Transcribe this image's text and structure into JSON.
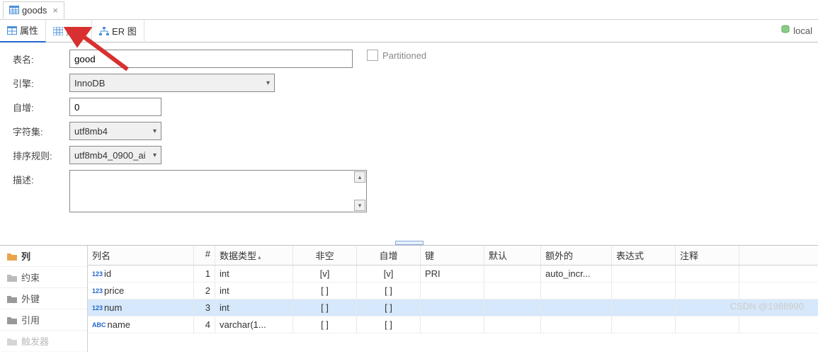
{
  "topTab": {
    "title": "goods"
  },
  "subtabs": {
    "properties": "属性",
    "data": "数据",
    "erDiagram": "ER 图"
  },
  "breadcrumb": {
    "local": "local"
  },
  "form": {
    "tableNameLabel": "表名:",
    "tableNameValue": "good",
    "engineLabel": "引擎:",
    "engineValue": "InnoDB",
    "autoIncLabel": "自增:",
    "autoIncValue": "0",
    "charsetLabel": "字符集:",
    "charsetValue": "utf8mb4",
    "collationLabel": "排序规则:",
    "collationValue": "utf8mb4_0900_ai",
    "descLabel": "描述:",
    "partitioned": "Partitioned"
  },
  "leftNav": {
    "columns": "列",
    "constraints": "约束",
    "foreignKeys": "外键",
    "references": "引用",
    "triggers": "触发器"
  },
  "tableHeaders": {
    "name": "列名",
    "idx": "#",
    "type": "数据类型",
    "notnull": "非空",
    "auto": "自增",
    "key": "键",
    "default": "默认",
    "extra": "额外的",
    "expr": "表达式",
    "comment": "注释"
  },
  "rows": [
    {
      "icon": "123",
      "name": "id",
      "idx": "1",
      "type": "int",
      "notnull": "[v]",
      "auto": "[v]",
      "key": "PRI",
      "def": "",
      "extra": "auto_incr...",
      "expr": "",
      "comm": ""
    },
    {
      "icon": "123",
      "name": "price",
      "idx": "2",
      "type": "int",
      "notnull": "[ ]",
      "auto": "[ ]",
      "key": "",
      "def": "",
      "extra": "",
      "expr": "",
      "comm": ""
    },
    {
      "icon": "123",
      "name": "num",
      "idx": "3",
      "type": "int",
      "notnull": "[ ]",
      "auto": "[ ]",
      "key": "",
      "def": "",
      "extra": "",
      "expr": "",
      "comm": "",
      "selected": true
    },
    {
      "icon": "ABC",
      "name": "name",
      "idx": "4",
      "type": "varchar(1...",
      "notnull": "[ ]",
      "auto": "[ ]",
      "key": "",
      "def": "",
      "extra": "",
      "expr": "",
      "comm": ""
    }
  ],
  "watermark": "CSDN @1988990"
}
